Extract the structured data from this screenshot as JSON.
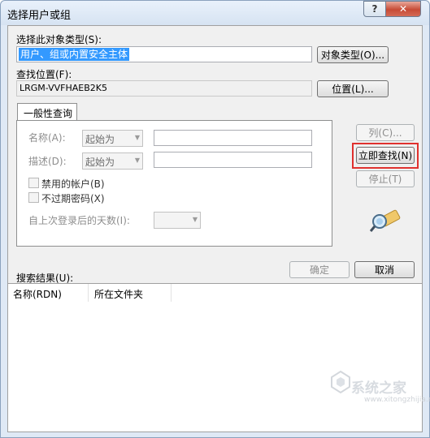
{
  "window": {
    "title": "选择用户或组",
    "help_label": "?",
    "close_label": "✕"
  },
  "object_type": {
    "label": "选择此对象类型(S):",
    "value": "用户、组或内置安全主体",
    "button": "对象类型(O)..."
  },
  "location": {
    "label": "查找位置(F):",
    "value": "LRGM-VVFHAEB2K5",
    "button": "位置(L)..."
  },
  "tabs": [
    {
      "label": "一般性查询"
    }
  ],
  "query": {
    "name_label": "名称(A):",
    "name_mode": "起始为",
    "name_value": "",
    "desc_label": "描述(D):",
    "desc_mode": "起始为",
    "desc_value": "",
    "disabled_accounts_label": "禁用的帐户(B)",
    "no_expire_label": "不过期密码(X)",
    "days_label": "自上次登录后的天数(I):",
    "days_value": ""
  },
  "side_buttons": {
    "columns": "列(C)...",
    "find_now": "立即查找(N)",
    "stop": "停止(T)"
  },
  "dialog_buttons": {
    "ok": "确定",
    "cancel": "取消"
  },
  "results": {
    "label": "搜索结果(U):",
    "columns": [
      "名称(RDN)",
      "所在文件夹"
    ],
    "rows": []
  },
  "watermark": {
    "text": "系统之家",
    "url": "www.xitongzhijia.net"
  },
  "icons": {
    "find": "search-binoculars-icon",
    "dropdown": "chevron-down-icon"
  },
  "colors": {
    "highlight": "#e0312e",
    "selection": "#3399ff",
    "close_button": "#c74b36"
  }
}
